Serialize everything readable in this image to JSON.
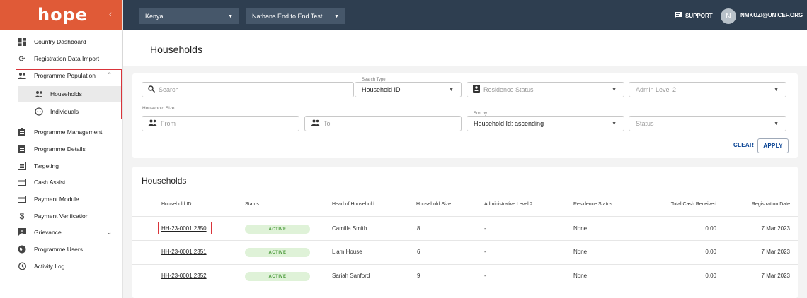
{
  "sidebar": {
    "logo": "hope",
    "collapse_icon": "chevron-left-icon",
    "items": [
      {
        "label": "Country Dashboard",
        "icon": "dashboard-icon"
      },
      {
        "label": "Registration Data Import",
        "icon": "sync-icon"
      },
      {
        "label": "Programme Population",
        "icon": "people-icon"
      },
      {
        "label": "Households",
        "icon": "household-icon"
      },
      {
        "label": "Individuals",
        "icon": "face-icon"
      },
      {
        "label": "Programme Management",
        "icon": "clipboard-icon"
      },
      {
        "label": "Programme Details",
        "icon": "clipboard-icon"
      },
      {
        "label": "Targeting",
        "icon": "list-icon"
      },
      {
        "label": "Cash Assist",
        "icon": "card-icon"
      },
      {
        "label": "Payment Module",
        "icon": "card-icon"
      },
      {
        "label": "Payment Verification",
        "icon": "dollar-icon"
      },
      {
        "label": "Grievance",
        "icon": "feedback-icon"
      },
      {
        "label": "Programme Users",
        "icon": "globe-icon"
      },
      {
        "label": "Activity Log",
        "icon": "history-icon"
      }
    ]
  },
  "topbar": {
    "country": "Kenya",
    "programme": "Nathans End to End Test",
    "support": "SUPPORT",
    "avatar_initial": "N",
    "user": "NMKUZI@UNICEF.ORG"
  },
  "page": {
    "title": "Households"
  },
  "filters": {
    "search_placeholder": "Search",
    "search_type_label": "Search Type",
    "search_type_value": "Household ID",
    "residence_status_placeholder": "Residence Status",
    "admin_level_placeholder": "Admin Level 2",
    "household_size_label": "Household Size",
    "from_placeholder": "From",
    "to_placeholder": "To",
    "sort_by_label": "Sort by",
    "sort_by_value": "Household Id: ascending",
    "status_placeholder": "Status",
    "clear_label": "CLEAR",
    "apply_label": "APPLY"
  },
  "table": {
    "title": "Households",
    "columns": [
      "Household ID",
      "Status",
      "Head of Household",
      "Household Size",
      "Administrative Level 2",
      "Residence Status",
      "Total Cash Received",
      "Registration Date"
    ],
    "rows": [
      {
        "id": "HH-23-0001.2350",
        "status": "ACTIVE",
        "head": "Camilla Smith",
        "size": "8",
        "admin2": "-",
        "residence": "None",
        "cash": "0.00",
        "date": "7 Mar 2023"
      },
      {
        "id": "HH-23-0001.2351",
        "status": "ACTIVE",
        "head": "Liam House",
        "size": "6",
        "admin2": "-",
        "residence": "None",
        "cash": "0.00",
        "date": "7 Mar 2023"
      },
      {
        "id": "HH-23-0001.2352",
        "status": "ACTIVE",
        "head": "Sariah Sanford",
        "size": "9",
        "admin2": "-",
        "residence": "None",
        "cash": "0.00",
        "date": "7 Mar 2023"
      }
    ]
  },
  "colors": {
    "brand": "#E05A37",
    "topbar": "#2E3E50",
    "highlight": "#D9343A",
    "active_badge": "#DFF2D8",
    "link": "#033F91"
  }
}
